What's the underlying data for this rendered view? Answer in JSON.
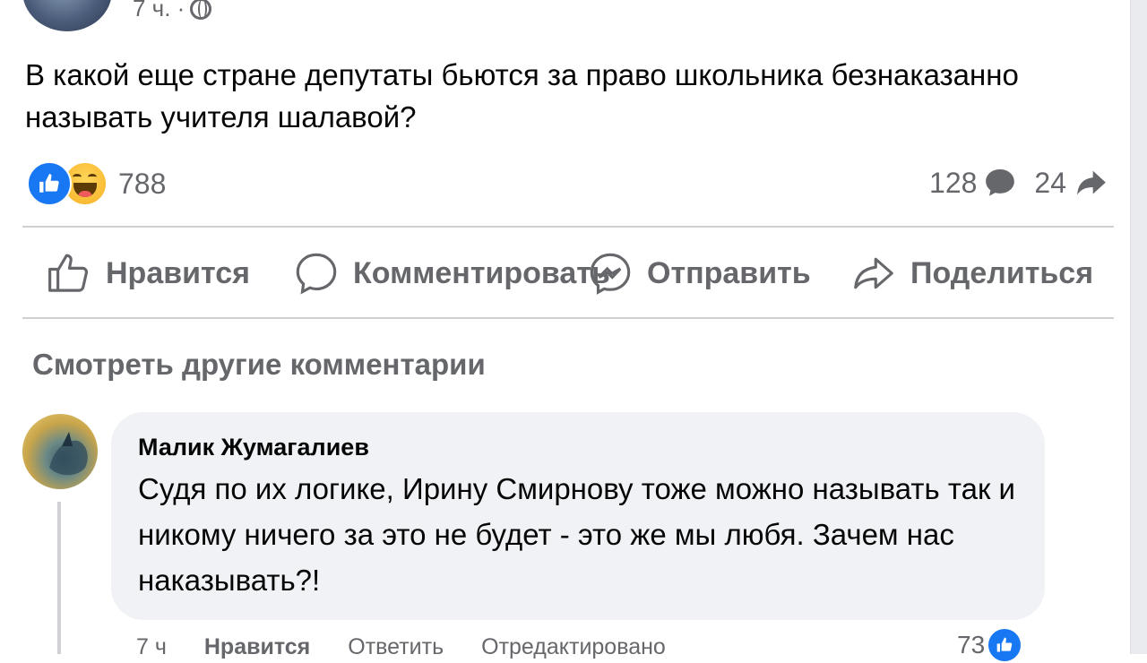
{
  "post": {
    "time": "7 ч. ·",
    "text": "В какой еще стране депутаты бьются за право школьника безнаказанно называть учителя шалавой?",
    "reactions_count": "788",
    "comments_count": "128",
    "shares_count": "24"
  },
  "actions": {
    "like": "Нравится",
    "comment": "Комментировать",
    "send": "Отправить",
    "share": "Поделиться"
  },
  "more_comments": "Смотреть другие комментарии",
  "comment": {
    "author": "Малик Жумагалиев",
    "text": "Судя по их логике, Ирину Смирнову тоже можно называть так и никому ничего за это не будет - это же мы любя. Зачем нас наказывать?!",
    "time": "7 ч",
    "like": "Нравится",
    "reply": "Ответить",
    "edited": "Отредактировано",
    "reactions_count": "73"
  },
  "colors": {
    "accent": "#1877f2",
    "secondary_text": "#65676b",
    "bubble_bg": "#f0f2f5",
    "divider": "#ced0d4"
  }
}
